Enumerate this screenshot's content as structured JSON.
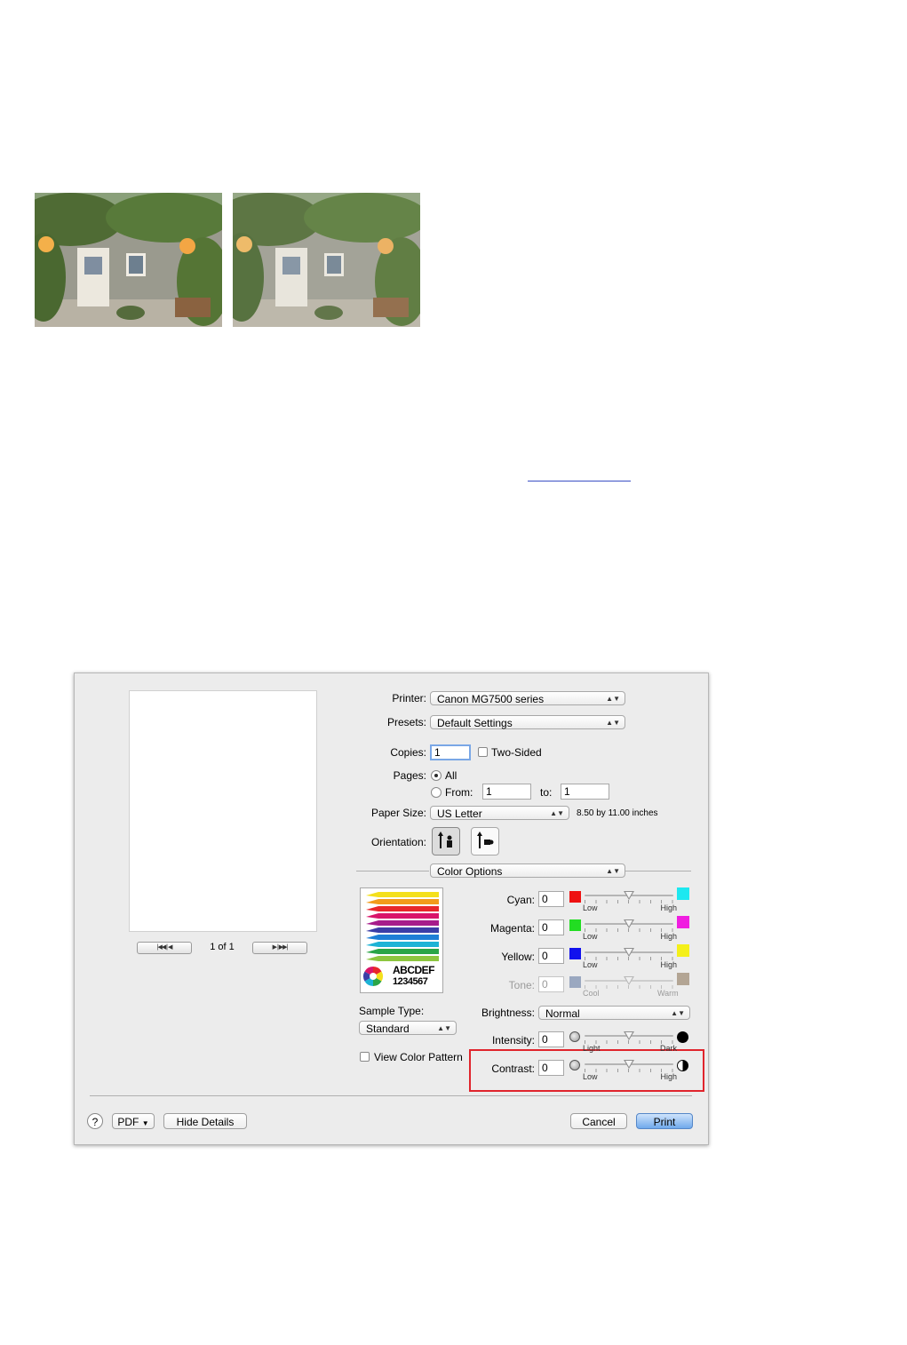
{
  "dialog": {
    "preview": {
      "page_label": "1 of 1"
    },
    "printer": {
      "label": "Printer:",
      "value": "Canon MG7500 series"
    },
    "presets": {
      "label": "Presets:",
      "value": "Default Settings"
    },
    "copies": {
      "label": "Copies:",
      "value": "1",
      "two_sided_label": "Two-Sided",
      "two_sided_checked": false
    },
    "pages": {
      "label": "Pages:",
      "all_label": "All",
      "from_label": "From:",
      "from_value": "1",
      "to_label": "to:",
      "to_value": "1",
      "selected": "All"
    },
    "paper_size": {
      "label": "Paper Size:",
      "value": "US Letter",
      "dims": "8.50 by 11.00 inches"
    },
    "orientation": {
      "label": "Orientation:",
      "selected": "portrait"
    },
    "section": {
      "value": "Color Options"
    },
    "thumbnail": {
      "text1": "ABCDEF",
      "text2": "1234567"
    },
    "sample_type": {
      "label": "Sample Type:",
      "value": "Standard"
    },
    "view_color_pattern": {
      "label": "View Color Pattern",
      "checked": false
    },
    "brightness": {
      "label": "Brightness:",
      "value": "Normal"
    },
    "sliders": [
      {
        "label": "Cyan:",
        "value": "0",
        "low": "Low",
        "high": "High",
        "left_color": "#ee1111",
        "right_color": "#1de8f0",
        "enabled": true
      },
      {
        "label": "Magenta:",
        "value": "0",
        "low": "Low",
        "high": "High",
        "left_color": "#22dd22",
        "right_color": "#f01ee0",
        "enabled": true
      },
      {
        "label": "Yellow:",
        "value": "0",
        "low": "Low",
        "high": "High",
        "left_color": "#1111ee",
        "right_color": "#f4f01a",
        "enabled": true
      },
      {
        "label": "Tone:",
        "value": "0",
        "low": "Cool",
        "high": "Warm",
        "left_color": "#9aa8c0",
        "right_color": "#b3a594",
        "enabled": false
      },
      {
        "label": "Intensity:",
        "value": "0",
        "low": "Light",
        "high": "Dark",
        "left_icon": "light-circle-icon",
        "right_icon": "dark-circle-icon",
        "enabled": true
      },
      {
        "label": "Contrast:",
        "value": "0",
        "low": "Low",
        "high": "High",
        "left_icon": "light-circle-icon",
        "right_icon": "half-circle-contrast-icon",
        "enabled": true
      }
    ],
    "footer": {
      "help": "?",
      "pdf": "PDF",
      "hide_details": "Hide Details",
      "cancel": "Cancel",
      "print": "Print"
    }
  },
  "colors": {
    "highlight": "#e0242c",
    "primary_button": "#6fa9ec"
  }
}
